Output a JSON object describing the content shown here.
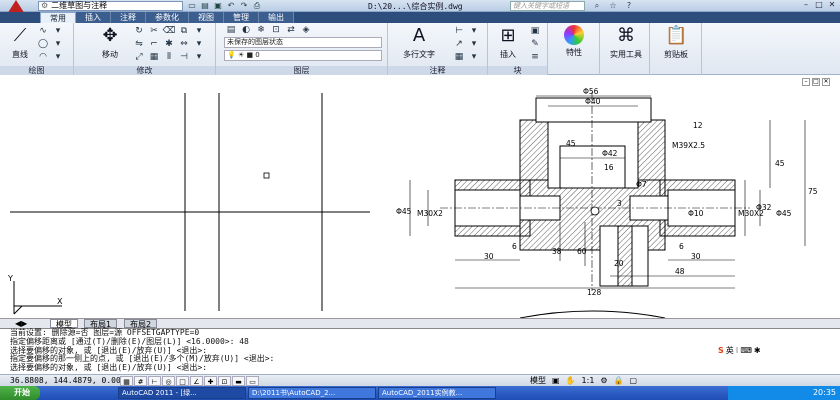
{
  "title_bar": {
    "workspace": "二维草图与注释",
    "document_title": "D:\\20...\\综合实例.dwg",
    "search_placeholder": "键入关键字或短语",
    "qat_icons": [
      "new-icon",
      "open-icon",
      "save-icon",
      "undo-icon",
      "redo-icon",
      "plot-icon"
    ]
  },
  "ribbon_tabs": [
    "常用",
    "插入",
    "注释",
    "参数化",
    "视图",
    "管理",
    "输出"
  ],
  "ribbon": {
    "draw": {
      "label": "绘图",
      "line": "直线"
    },
    "modify": {
      "label": "修改",
      "move": "移动"
    },
    "layers": {
      "label": "图层",
      "state": "未保存的图层状态",
      "current": "0"
    },
    "annotation": {
      "label": "注释",
      "mtext": "多行文字"
    },
    "block": {
      "label": "块",
      "insert": "插入"
    },
    "properties": {
      "label": "特性"
    },
    "utilities": {
      "label": "实用工具"
    },
    "clipboard": {
      "label": "剪贴板"
    }
  },
  "drawing": {
    "dims": {
      "d56": "Φ56",
      "d40": "Φ40",
      "d42": "Φ42",
      "d7": "Φ7",
      "d45_left": "Φ45",
      "m30_left": "M30X2",
      "d45_right": "Φ45",
      "m30_right": "M30X2",
      "d10": "Φ10",
      "d32": "Φ32",
      "m39": "M39X2.5",
      "n16": "16",
      "n45v": "45",
      "n12": "12",
      "n75": "75",
      "n45r": "45",
      "n30_left": "30",
      "n6_left": "6",
      "n30_right": "30",
      "n6_right": "6",
      "n48": "48",
      "n128": "128",
      "n38": "38",
      "n60": "60",
      "n20": "20",
      "n3": "3"
    },
    "ucs_x": "X",
    "ucs_y": "Y"
  },
  "layout_tabs": [
    "模型",
    "布局1",
    "布局2"
  ],
  "command_lines": [
    "当前设置: 删除源=否  图层=源  OFFSETGAPTYPE=0",
    "指定偏移距离或 [通过(T)/删除(E)/图层(L)] <16.0000>:  48",
    "选择要偏移的对象, 或 [退出(E)/放弃(U)] <退出>:",
    "指定要偏移的那一侧上的点, 或 [退出(E)/多个(M)/放弃(U)] <退出>:",
    "选择要偏移的对象, 或 [退出(E)/放弃(U)] <退出>:"
  ],
  "ime": {
    "label": "英"
  },
  "status": {
    "coords": "36.8808, 144.4879, 0.0000",
    "model": "模型",
    "scale": "1:1"
  },
  "taskbar": {
    "start": "开始",
    "tasks": [
      "AutoCAD 2011 - [绿...",
      "D:\\2011书\\AutoCAD_2...",
      "AutoCAD_2011实例教..."
    ],
    "clock": "20:35"
  },
  "colors": {
    "title_blue": "#2d4e7d",
    "taskbar": "#2454c4",
    "start_green": "#3a9e36",
    "hatch": "#333333"
  }
}
